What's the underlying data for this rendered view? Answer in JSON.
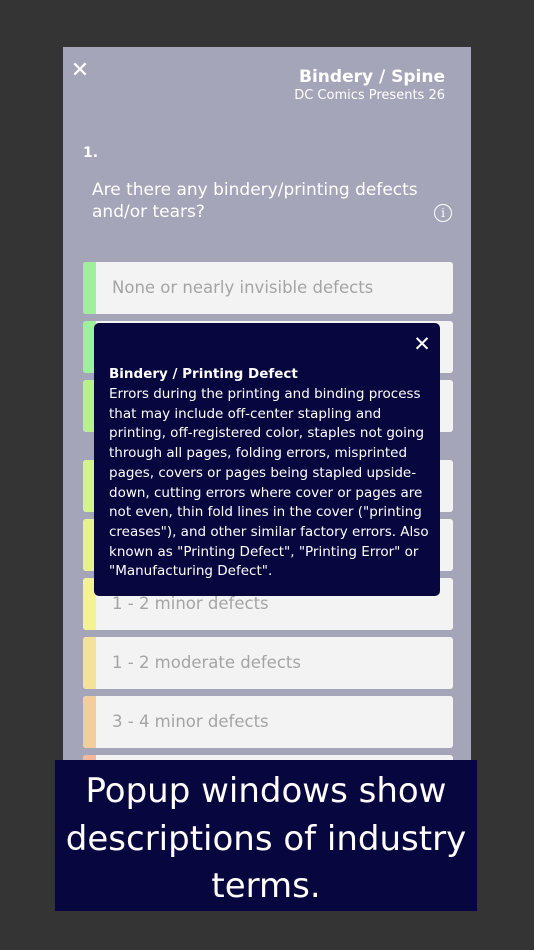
{
  "header": {
    "close_icon": "close-icon",
    "title": "Bindery / Spine",
    "subtitle": "DC Comics Presents 26"
  },
  "question": {
    "number": "1.",
    "text": "Are there any bindery/printing defects and/or tears?",
    "info_icon": "info-icon",
    "info_glyph": "i"
  },
  "options": [
    {
      "label": "None or nearly invisible defects",
      "color": "#9ef09c"
    },
    {
      "label": "",
      "color": "#9ef09c"
    },
    {
      "label": "",
      "color": "#b8f08e"
    },
    {
      "label": "",
      "color": "#d4f28e"
    },
    {
      "label": "",
      "color": "#e6f28f"
    },
    {
      "label": "1 - 2 minor defects",
      "color": "#f3f394"
    },
    {
      "label": "1 - 2 moderate defects",
      "color": "#f3e39a"
    },
    {
      "label": "3 - 4 minor defects",
      "color": "#f3cd9c"
    },
    {
      "label": "",
      "color": "#f3b89c"
    }
  ],
  "popup": {
    "close_icon": "close-icon",
    "title": "Bindery / Printing Defect",
    "body": "Errors during the printing and binding process that may include off-center stapling and printing, off-registered color, staples not going through all pages, folding errors, misprinted pages, covers or pages being stapled upside-down, cutting errors where cover or pages are not even, thin fold lines in the cover (\"printing creases\"), and other similar factory errors. Also known as \"Printing Defect\", \"Printing Error\" or \"Manufacturing Defect\"."
  },
  "caption": {
    "text": "Popup windows show descriptions of industry terms."
  },
  "colors": {
    "background": "#343434",
    "panel": "#a5a5b9",
    "popup": "#07063f"
  }
}
